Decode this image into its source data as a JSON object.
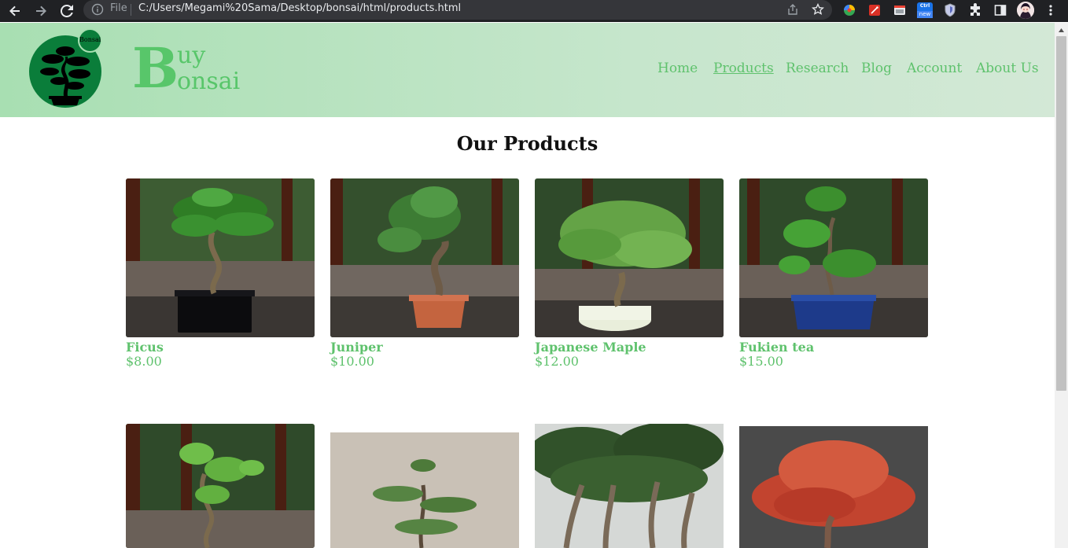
{
  "browser": {
    "scheme_label": "File",
    "url": "C:/Users/Megami%20Sama/Desktop/bonsai/html/products.html",
    "extension_new_label": "new",
    "extension_tiny_label": "Ctrl"
  },
  "header": {
    "logo_badge_text": "Bonsai",
    "brand_big_letter": "B",
    "brand_line1": "uy",
    "brand_line2": "onsai",
    "nav": [
      {
        "label": "Home",
        "active": false
      },
      {
        "label": "Products",
        "active": true
      },
      {
        "label": "Research",
        "active": false
      },
      {
        "label": "Blog",
        "active": false
      },
      {
        "label": "Account",
        "active": false
      },
      {
        "label": "About Us",
        "active": false
      }
    ]
  },
  "main": {
    "title": "Our Products",
    "products": [
      {
        "name": "Ficus",
        "price": "$8.00"
      },
      {
        "name": "Juniper",
        "price": "$10.00"
      },
      {
        "name": "Japanese Maple",
        "price": "$12.00"
      },
      {
        "name": "Fukien tea",
        "price": "$15.00"
      }
    ]
  },
  "colors": {
    "accent_green": "#5fc26d",
    "header_bg": "#a8dfb2",
    "logo_green": "#0a7d3a"
  }
}
